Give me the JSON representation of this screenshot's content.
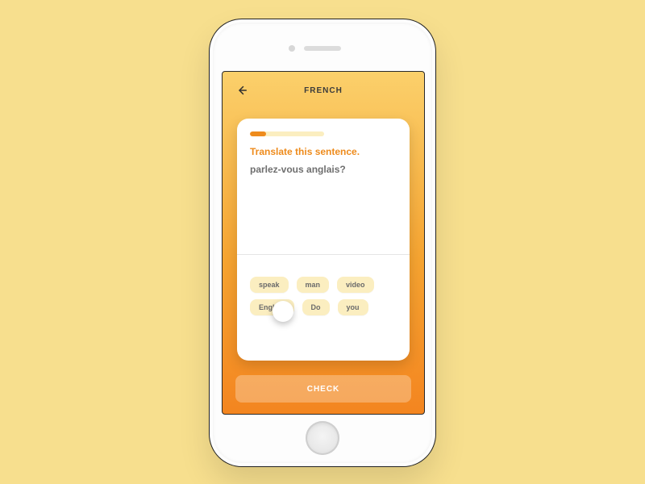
{
  "header": {
    "title": "FRENCH"
  },
  "card": {
    "progress_pct": 22,
    "instruction": "Translate this sentence.",
    "sentence": "parlez-vous anglais?"
  },
  "wordbank": [
    "speak",
    "man",
    "video",
    "English",
    "Do",
    "you"
  ],
  "footer": {
    "check_label": "CHECK"
  },
  "colors": {
    "accent": "#ee8b1c",
    "chip_bg": "#fbeec0"
  }
}
